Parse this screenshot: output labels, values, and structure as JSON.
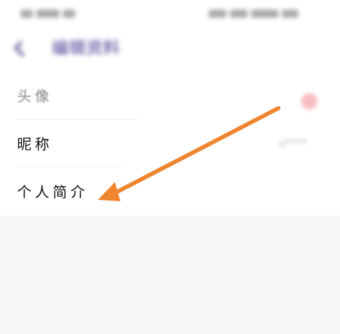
{
  "statusBar": {
    "left": "■ 5:07 ◻",
    "right": "▲ ■ 100%"
  },
  "header": {
    "backIcon": "back-arrow-icon",
    "title": "编辑资料"
  },
  "rows": [
    {
      "label": "头像",
      "valueIcon": "avatar-icon"
    },
    {
      "label": "昵称",
      "value": "u****"
    },
    {
      "label": "个人简介"
    }
  ],
  "colors": {
    "accent": "#5d4b9b",
    "arrow": "#f0852f",
    "background": "#f7f6f8",
    "avatar": "#f7aeb4"
  },
  "annotation": {
    "icon": "orange-arrow-icon",
    "target": "个人简介"
  }
}
